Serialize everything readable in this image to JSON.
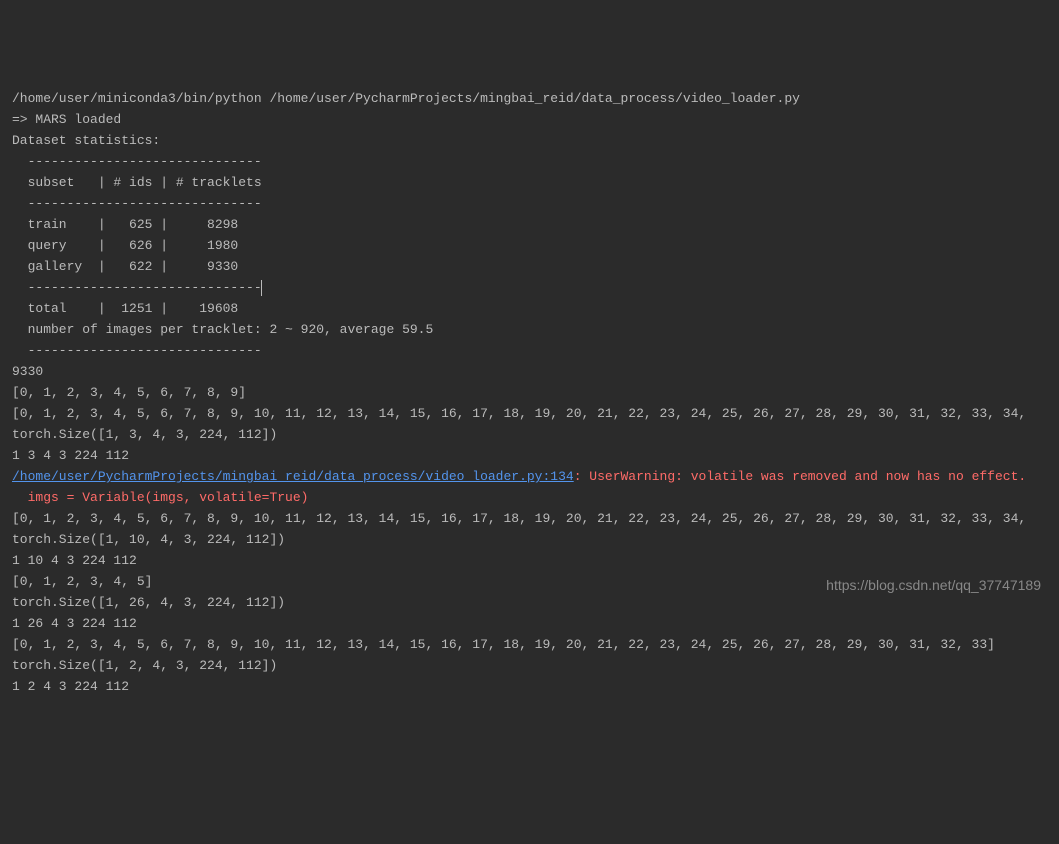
{
  "terminal": {
    "command": "/home/user/miniconda3/bin/python /home/user/PycharmProjects/mingbai_reid/data_process/video_loader.py",
    "line01": "=> MARS loaded",
    "line02": "Dataset statistics:",
    "line03": "  ------------------------------",
    "line04": "  subset   | # ids | # tracklets",
    "line05": "  ------------------------------",
    "line06": "  train    |   625 |     8298",
    "line07": "  query    |   626 |     1980",
    "line08": "  gallery  |   622 |     9330",
    "line09": "  ------------------------------",
    "line10": "  total    |  1251 |    19608",
    "line11": "  number of images per tracklet: 2 ~ 920, average 59.5",
    "line12": "  ------------------------------",
    "line13": "9330",
    "line14": "[0, 1, 2, 3, 4, 5, 6, 7, 8, 9]",
    "line15": "[0, 1, 2, 3, 4, 5, 6, 7, 8, 9, 10, 11, 12, 13, 14, 15, 16, 17, 18, 19, 20, 21, 22, 23, 24, 25, 26, 27, 28, 29, 30, 31, 32, 33, 34,",
    "line16": "torch.Size([1, 3, 4, 3, 224, 112])",
    "line17": "1 3 4 3 224 112",
    "warning_file": "/home/user/PycharmProjects/mingbai_reid/data_process/video_loader.py:134",
    "warning_msg": ": UserWarning: volatile was removed and now has no effect.",
    "warning_code": "  imgs = Variable(imgs, volatile=True)",
    "line20": "[0, 1, 2, 3, 4, 5, 6, 7, 8, 9, 10, 11, 12, 13, 14, 15, 16, 17, 18, 19, 20, 21, 22, 23, 24, 25, 26, 27, 28, 29, 30, 31, 32, 33, 34,",
    "line21": "torch.Size([1, 10, 4, 3, 224, 112])",
    "line22": "1 10 4 3 224 112",
    "line23": "[0, 1, 2, 3, 4, 5]",
    "line24": "torch.Size([1, 26, 4, 3, 224, 112])",
    "line25": "1 26 4 3 224 112",
    "line26": "[0, 1, 2, 3, 4, 5, 6, 7, 8, 9, 10, 11, 12, 13, 14, 15, 16, 17, 18, 19, 20, 21, 22, 23, 24, 25, 26, 27, 28, 29, 30, 31, 32, 33]",
    "line27": "torch.Size([1, 2, 4, 3, 224, 112])",
    "line28": "1 2 4 3 224 112"
  },
  "watermark": "https://blog.csdn.net/qq_37747189"
}
